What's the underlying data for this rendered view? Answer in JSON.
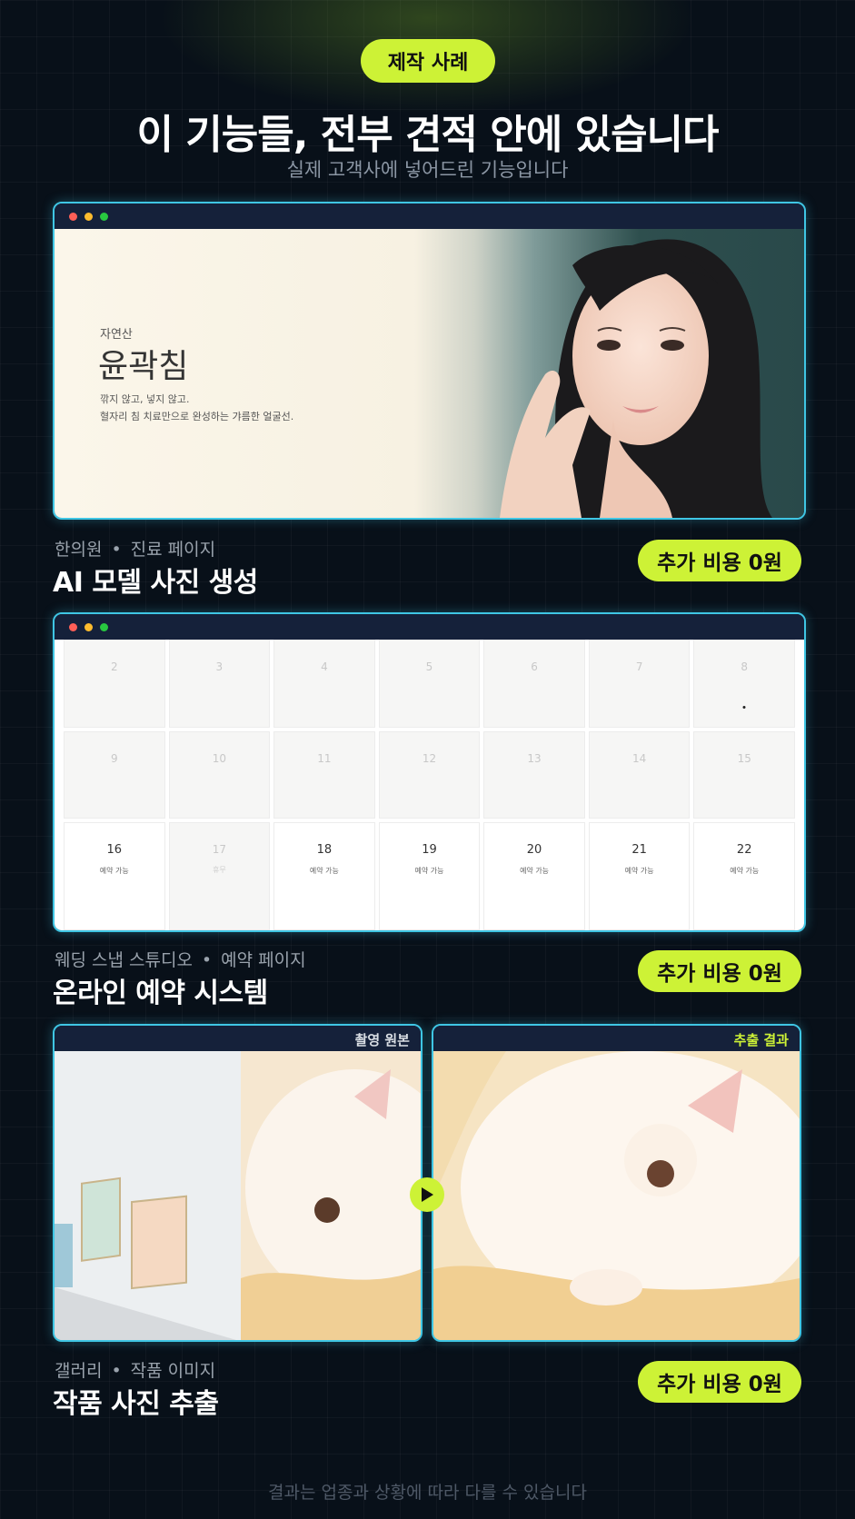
{
  "header": {
    "badge": "제작 사례",
    "title": "이 기능들, 전부 견적 안에 있습니다",
    "subtitle": "실제 고객사에 넣어드린 기능입니다"
  },
  "colors": {
    "accent": "#cdf236",
    "frame": "#3fc6e4",
    "background": "#081019"
  },
  "cases": [
    {
      "category": "한의원",
      "page": "진료 페이지",
      "feature": "AI 모델 사진 생성",
      "price": "추가 비용 0원",
      "preview": {
        "eyebrow": "자연산",
        "headline": "윤곽침",
        "desc_line1": "깎지 않고, 넣지 않고.",
        "desc_line2": "혈자리 침 치료만으로 완성하는 갸름한 얼굴선."
      }
    },
    {
      "category": "웨딩 스냅 스튜디오",
      "page": "예약 페이지",
      "feature": "온라인 예약 시스템",
      "price": "추가 비용 0원",
      "calendar": {
        "rows": [
          [
            {
              "d": "2"
            },
            {
              "d": "3"
            },
            {
              "d": "4"
            },
            {
              "d": "5"
            },
            {
              "d": "6"
            },
            {
              "d": "7"
            },
            {
              "d": "8"
            }
          ],
          [
            {
              "d": "9"
            },
            {
              "d": "10"
            },
            {
              "d": "11"
            },
            {
              "d": "12"
            },
            {
              "d": "13"
            },
            {
              "d": "14"
            },
            {
              "d": "15"
            }
          ],
          [
            {
              "d": "16",
              "s": "예약 가능"
            },
            {
              "d": "17",
              "s": "휴무"
            },
            {
              "d": "18",
              "s": "예약 가능"
            },
            {
              "d": "19",
              "s": "예약 가능"
            },
            {
              "d": "20",
              "s": "예약 가능"
            },
            {
              "d": "21",
              "s": "예약 가능"
            },
            {
              "d": "22",
              "s": "예약 가능"
            }
          ]
        ]
      }
    },
    {
      "category": "갤러리",
      "page": "작품 이미지",
      "feature": "작품 사진 추출",
      "price": "추가 비용 0원",
      "before_label": "촬영 원본",
      "after_label": "추출 결과"
    }
  ],
  "separator": "•",
  "footer": "결과는 업종과 상황에 따라 다를 수 있습니다"
}
